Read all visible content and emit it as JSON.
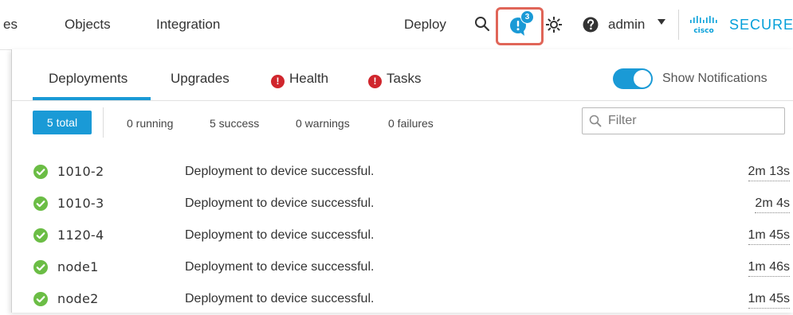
{
  "topnav": {
    "partial_item": "es",
    "objects": "Objects",
    "integration": "Integration",
    "deploy": "Deploy",
    "notification_count": "3",
    "user": "admin",
    "brand_word": "SECURE",
    "logo_text": "cisco"
  },
  "panel": {
    "tabs": [
      {
        "label": "Deployments",
        "active": true,
        "alert": false
      },
      {
        "label": "Upgrades",
        "active": false,
        "alert": false
      },
      {
        "label": "Health",
        "active": false,
        "alert": true
      },
      {
        "label": "Tasks",
        "active": false,
        "alert": true
      }
    ],
    "show_notifications_label": "Show Notifications",
    "show_notifications_on": true,
    "summary": {
      "total": "5 total",
      "running": "0 running",
      "success": "5 success",
      "warnings": "0 warnings",
      "failures": "0 failures"
    },
    "filter_placeholder": "Filter",
    "rows": [
      {
        "device": "1010-2",
        "message": "Deployment to device successful.",
        "duration": "2m 13s"
      },
      {
        "device": "1010-3",
        "message": "Deployment to device successful.",
        "duration": "2m 4s"
      },
      {
        "device": "1120-4",
        "message": "Deployment to device successful.",
        "duration": "1m 45s"
      },
      {
        "device": "node1",
        "message": "Deployment to device successful.",
        "duration": "1m 46s"
      },
      {
        "device": "node2",
        "message": "Deployment to device successful.",
        "duration": "1m 45s"
      }
    ]
  },
  "colors": {
    "accent": "#1a9ad6",
    "success": "#6bbd45",
    "alert": "#d0262d",
    "highlight": "#e06558",
    "brand": "#049fd9"
  },
  "icons": {
    "search": "search-icon",
    "notifications": "notification-icon",
    "settings": "gear-icon",
    "help": "help-icon",
    "filter": "search-icon",
    "status_ok": "check-circle-icon"
  }
}
